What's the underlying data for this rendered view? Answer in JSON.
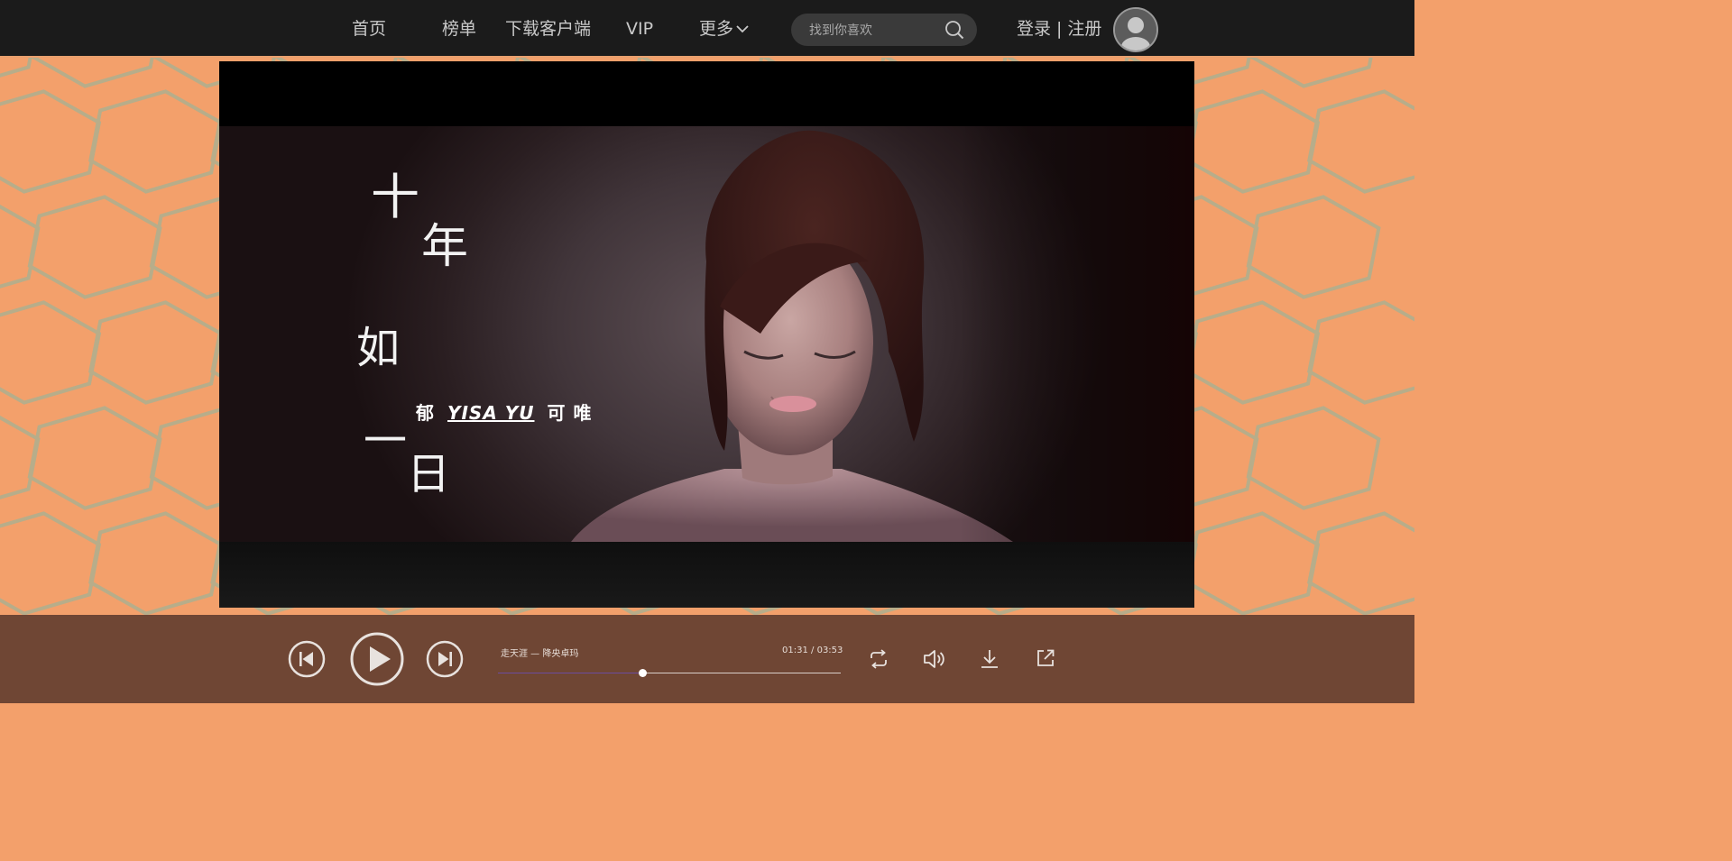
{
  "nav": {
    "items": [
      {
        "label": "首页"
      },
      {
        "label": "榜单"
      },
      {
        "label": "下载客户端"
      },
      {
        "label": "VIP"
      },
      {
        "label": "更多"
      }
    ],
    "search_placeholder": "找到你喜欢",
    "login_label": "登录",
    "separator": "|",
    "register_label": "注册"
  },
  "video": {
    "overlay_title_chars": [
      "十",
      "年",
      "如",
      "一",
      "日"
    ],
    "artist_parts": [
      "郁",
      "YISA YU",
      "可 唯"
    ]
  },
  "player": {
    "track_title": "走天涯 — 降央卓玛",
    "current_time": "01:31",
    "time_separator": "/",
    "total_time": "03:53",
    "progress": 0.42
  },
  "colors": {
    "page_background": "#f3a06b",
    "hex_lines": "#b7ad8a",
    "topbar": "#1b1b1b",
    "playerbar": "#6f4634",
    "progress_played": "#6c4c9f"
  },
  "icons": {
    "search": "magnifier",
    "avatar": "user-silhouette",
    "prev": "skip-previous",
    "play": "play",
    "next": "skip-next",
    "repeat": "repeat",
    "volume": "speaker",
    "download": "download-arrow",
    "share": "external-share",
    "more_dropdown": "chevron-down"
  }
}
